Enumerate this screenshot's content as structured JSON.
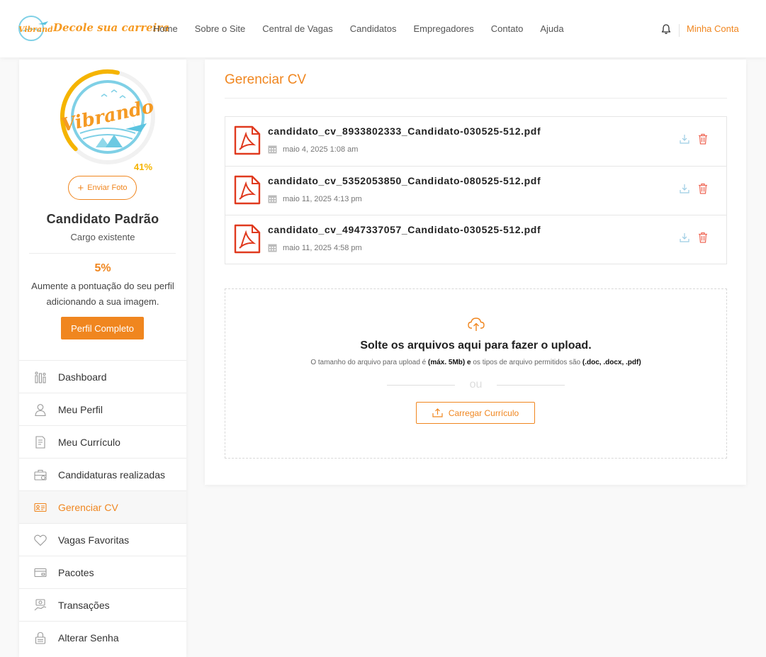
{
  "header": {
    "logo_tagline": "Decole sua carreira",
    "logo_brand": "Vibrando",
    "nav": [
      "Home",
      "Sobre o Site",
      "Central de Vagas",
      "Candidatos",
      "Empregadores",
      "Contato",
      "Ajuda"
    ],
    "account_label": "Minha Conta",
    "accent_color": "#f0861f"
  },
  "profile": {
    "avatar_brand": "Vibrando",
    "completion_ring": "41%",
    "completion_fraction": 0.41,
    "upload_photo_label": "Enviar Foto",
    "name": "Candidato Padrão",
    "role": "Cargo existente",
    "score": "5%",
    "score_hint": "Aumente a pontuação do seu perfil adicionando a sua imagem.",
    "complete_button": "Perfil Completo"
  },
  "menu": [
    {
      "label": "Dashboard",
      "icon": "dashboard-icon"
    },
    {
      "label": "Meu Perfil",
      "icon": "user-icon"
    },
    {
      "label": "Meu Currículo",
      "icon": "resume-icon"
    },
    {
      "label": "Candidaturas realizadas",
      "icon": "briefcase-icon"
    },
    {
      "label": "Gerenciar CV",
      "icon": "id-card-icon"
    },
    {
      "label": "Vagas Favoritas",
      "icon": "heart-icon"
    },
    {
      "label": "Pacotes",
      "icon": "package-icon"
    },
    {
      "label": "Transações",
      "icon": "transactions-icon"
    },
    {
      "label": "Alterar Senha",
      "icon": "lock-icon"
    }
  ],
  "main": {
    "title": "Gerenciar CV",
    "files": [
      {
        "name": "candidato_cv_8933802333_Candidato-030525-512.pdf",
        "date": "maio 4, 2025 1:08 am"
      },
      {
        "name": "candidato_cv_5352053850_Candidato-080525-512.pdf",
        "date": "maio 11, 2025 4:13 pm"
      },
      {
        "name": "candidato_cv_4947337057_Candidato-030525-512.pdf",
        "date": "maio 11, 2025 4:58 pm"
      }
    ],
    "upload": {
      "title": "Solte os arquivos aqui para fazer o upload.",
      "sub_prefix": "O tamanho do arquivo para upload é ",
      "sub_size": "(máx. 5Mb) e",
      "sub_middle": " os tipos de arquivo permitidos são ",
      "sub_types": "(.doc, .docx, .pdf)",
      "or": "ou",
      "button": "Carregar Currículo"
    }
  }
}
